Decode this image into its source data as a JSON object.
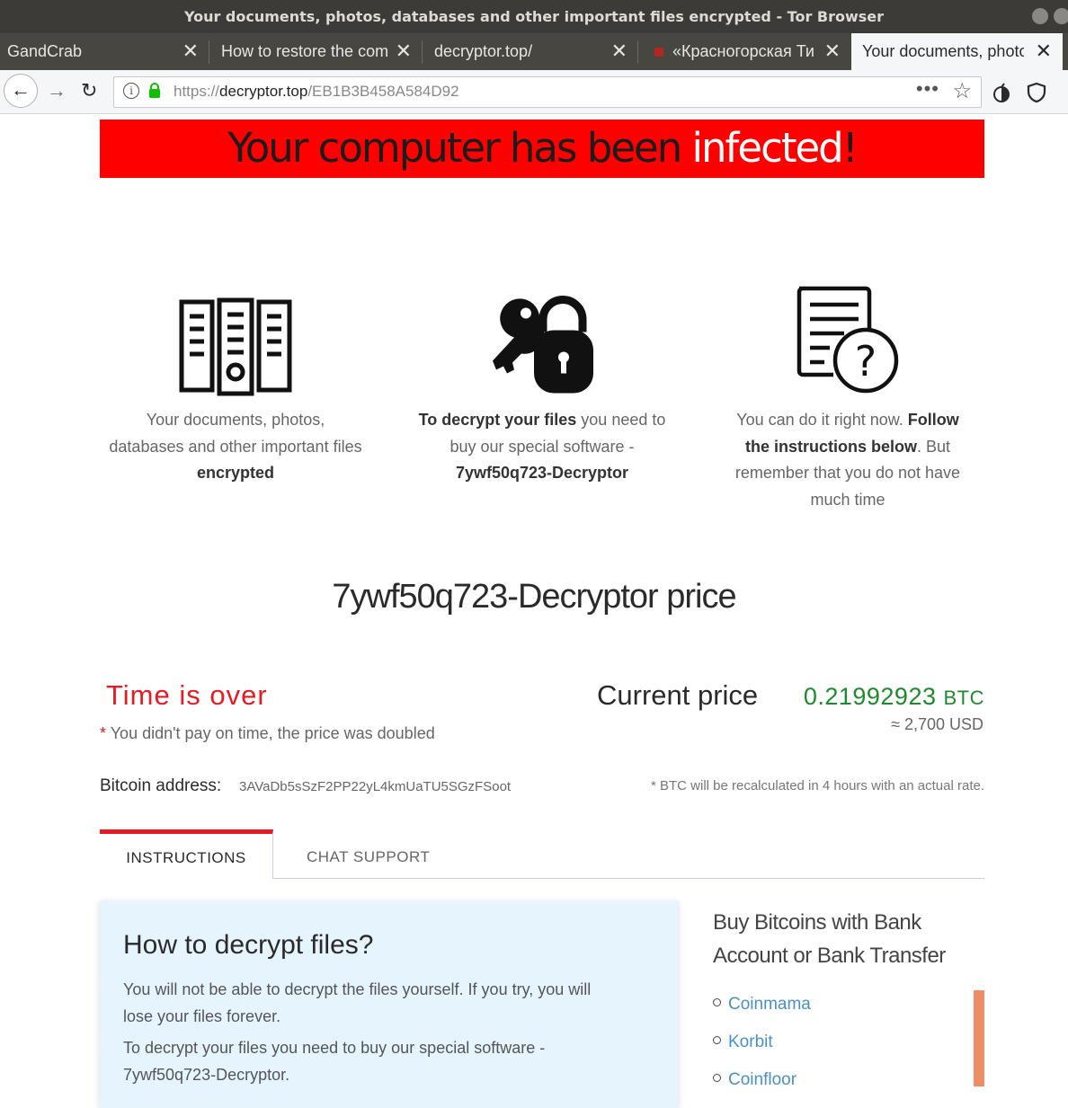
{
  "window": {
    "title": "Your documents, photos, databases and other important files encrypted - Tor Browser"
  },
  "tabs": [
    {
      "label": "GandCrab"
    },
    {
      "label": "How to restore the com"
    },
    {
      "label": "decryptor.top/"
    },
    {
      "label": "«Красногорская Ти"
    },
    {
      "label": "Your documents, photos"
    }
  ],
  "navbar": {
    "url_scheme": "https://",
    "url_host": "decryptor.top",
    "url_path": "/EB1B3B458A584D92"
  },
  "banner": {
    "part1": "Your computer has been ",
    "part2": "infected",
    "part3": "!"
  },
  "features": [
    {
      "icon": "file-cabinet-icon",
      "line1": "Your documents, photos,",
      "line2": "databases and other important files",
      "line3_bold": "encrypted"
    },
    {
      "icon": "key-padlock-icon",
      "line1_bold": "To decrypt your files",
      "line1_rest": " you need to",
      "line2": "buy our special software -",
      "line3_bold": "7ywf50q723-Decryptor"
    },
    {
      "icon": "document-question-icon",
      "line1": "You can do it right now. ",
      "line1_bold": "Follow",
      "line2_bold": "the instructions below",
      "line2_rest": ". But",
      "line3": "remember that you do not have",
      "line4": "much time"
    }
  ],
  "price": {
    "title": "7ywf50q723-Decryptor price",
    "status": "Time is over",
    "late_note": "You didn't pay on time, the price was doubled",
    "current_label": "Current price",
    "btc_value": "0.21992923",
    "btc_unit": "BTC",
    "usd_approx": "≈ 2,700 USD",
    "address_label": "Bitcoin address:",
    "address": "3AVaDb5sSzF2PP22yL4kmUaTU5SGzFSoot",
    "recalc_note": "* BTC will be recalculated in 4 hours with an actual rate."
  },
  "content_tabs": {
    "instructions": "INSTRUCTIONS",
    "chat": "CHAT SUPPORT"
  },
  "how_to": {
    "title": "How to decrypt files?",
    "p1_line1": "You will not be able to decrypt the files yourself. If you try, you will",
    "p1_line2": "lose your files forever.",
    "p2_line1": "To decrypt your files you need to buy our special software -",
    "p2_line2": "7ywf50q723-Decryptor."
  },
  "buy": {
    "title_line1": "Buy Bitcoins with Bank",
    "title_line2": "Account or Bank Transfer",
    "items": [
      "Coinmama",
      "Korbit",
      "Coinfloor"
    ]
  },
  "colors": {
    "banner_red": "#ff0000",
    "alert_red": "#e51c23",
    "btc_green": "#1e8a2e",
    "link_blue": "#4a90c8",
    "box_bg": "#e6f4fe",
    "accent_orange": "#ee8d67"
  }
}
